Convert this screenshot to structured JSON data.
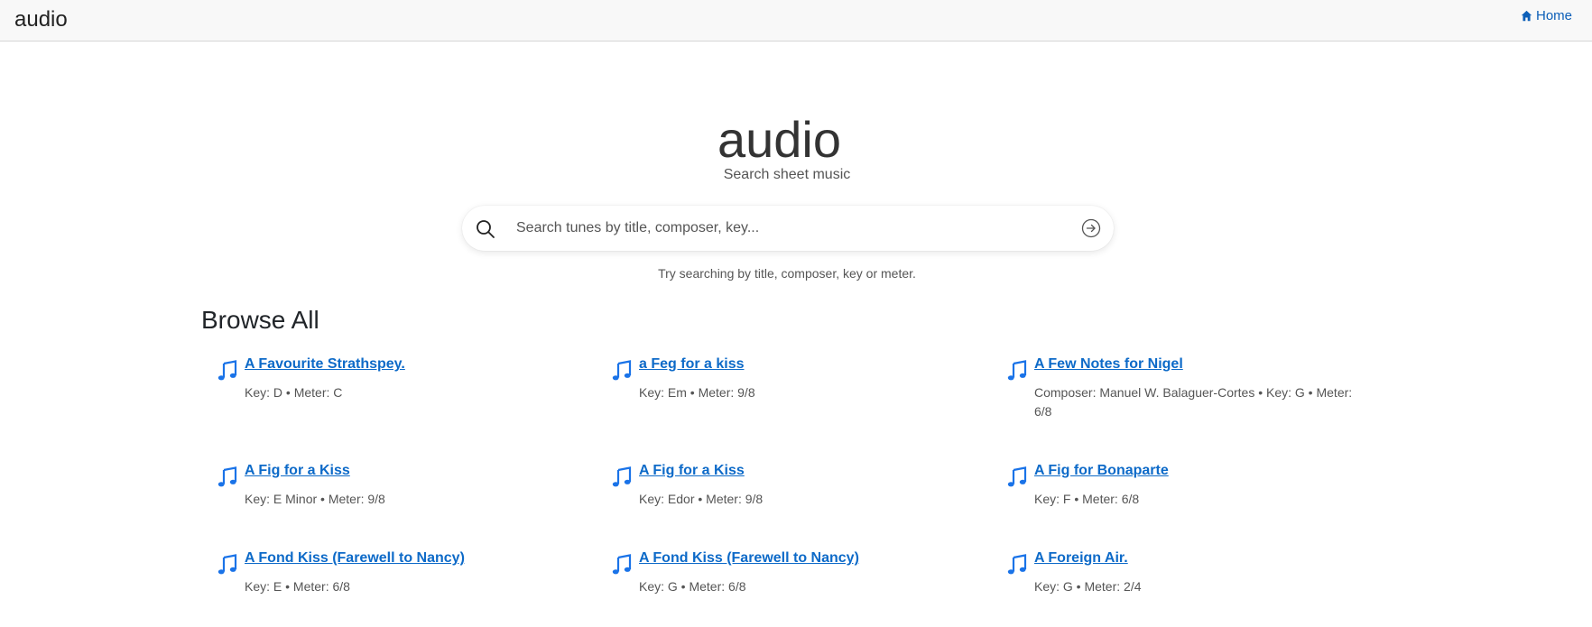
{
  "header": {
    "brand": "audio",
    "home_label": "Home"
  },
  "hero": {
    "logo_text": "audio",
    "tagline": "Search sheet music"
  },
  "search": {
    "placeholder": "Search tunes by title, composer, key...",
    "value": "",
    "hint": "Try searching by title, composer, key or meter."
  },
  "browse": {
    "heading": "Browse All",
    "tunes": [
      {
        "title": "A Favourite Strathspey.",
        "meta": "Key: D • Meter: C"
      },
      {
        "title": "a Feg for a kiss",
        "meta": "Key: Em • Meter: 9/8"
      },
      {
        "title": "A Few Notes for Nigel",
        "meta": "Composer: Manuel W. Balaguer-Cortes • Key: G • Meter: 6/8"
      },
      {
        "title": "A Fig for a Kiss",
        "meta": "Key: E Minor • Meter: 9/8"
      },
      {
        "title": "A Fig for a Kiss",
        "meta": "Key: Edor • Meter: 9/8"
      },
      {
        "title": "A Fig for Bonaparte",
        "meta": "Key: F • Meter: 6/8"
      },
      {
        "title": "A Fond Kiss (Farewell to Nancy)",
        "meta": "Key: E • Meter: 6/8"
      },
      {
        "title": "A Fond Kiss (Farewell to Nancy)",
        "meta": "Key: G • Meter: 6/8"
      },
      {
        "title": "A Foreign Air.",
        "meta": "Key: G • Meter: 2/4"
      }
    ]
  },
  "colors": {
    "link": "#0d6ac8",
    "note_icon": "#1a73e8",
    "logo": "#333333"
  }
}
